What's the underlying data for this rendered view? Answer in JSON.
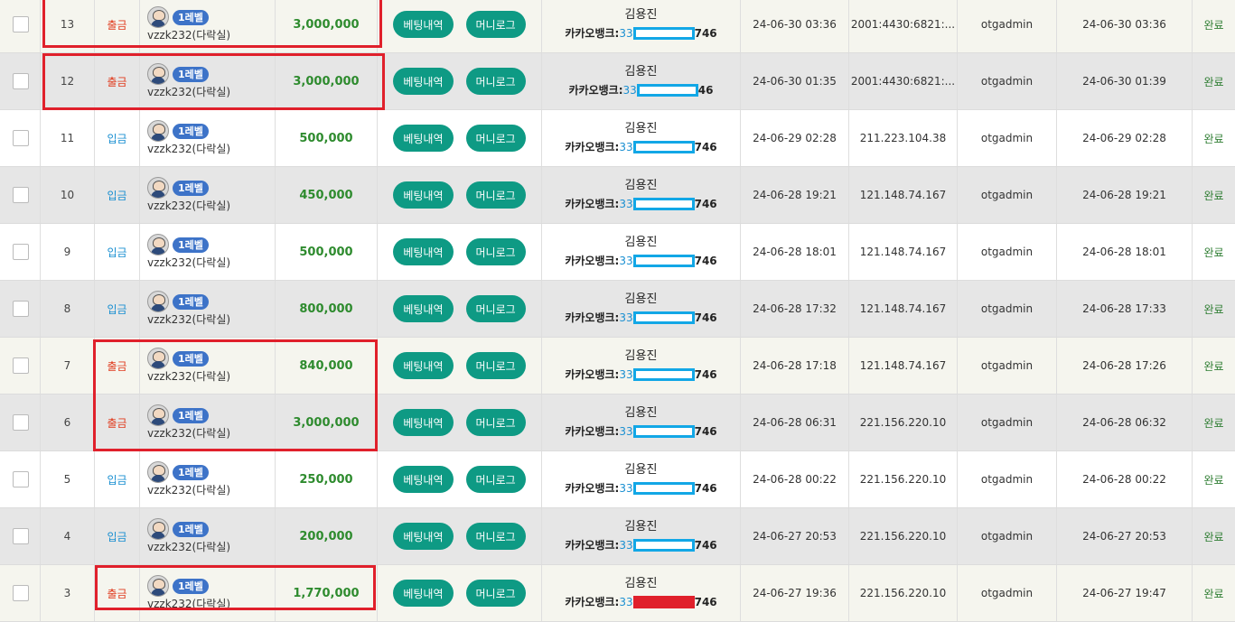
{
  "buttons": {
    "betting_label": "베팅내역",
    "money_label": "머니로그"
  },
  "rows": [
    {
      "no": "13",
      "type": "출금",
      "kind": "out",
      "level": "1레벨",
      "user": "vzzk232(다락실)",
      "amount": "3,000,000",
      "holder": "김용진",
      "bank_prefix": "카카오뱅크:",
      "acct_head": "33",
      "acct_tail": "746",
      "requested": "24-06-30 03:36",
      "ip": "2001:4430:6821:...",
      "admin": "otgadmin",
      "processed": "24-06-30 03:36",
      "status": "완료"
    },
    {
      "no": "12",
      "type": "출금",
      "kind": "out",
      "level": "1레벨",
      "user": "vzzk232(다락실)",
      "amount": "3,000,000",
      "holder": "김용진",
      "bank_prefix": "카카오뱅크:",
      "acct_head": "33",
      "acct_tail": "46",
      "requested": "24-06-30 01:35",
      "ip": "2001:4430:6821:...",
      "admin": "otgadmin",
      "processed": "24-06-30 01:39",
      "status": "완료"
    },
    {
      "no": "11",
      "type": "입금",
      "kind": "in",
      "level": "1레벨",
      "user": "vzzk232(다락실)",
      "amount": "500,000",
      "holder": "김용진",
      "bank_prefix": "카카오뱅크:",
      "acct_head": "33",
      "acct_tail": "746",
      "requested": "24-06-29 02:28",
      "ip": "211.223.104.38",
      "admin": "otgadmin",
      "processed": "24-06-29 02:28",
      "status": "완료"
    },
    {
      "no": "10",
      "type": "입금",
      "kind": "in",
      "level": "1레벨",
      "user": "vzzk232(다락실)",
      "amount": "450,000",
      "holder": "김용진",
      "bank_prefix": "카카오뱅크:",
      "acct_head": "33",
      "acct_tail": "746",
      "requested": "24-06-28 19:21",
      "ip": "121.148.74.167",
      "admin": "otgadmin",
      "processed": "24-06-28 19:21",
      "status": "완료"
    },
    {
      "no": "9",
      "type": "입금",
      "kind": "in",
      "level": "1레벨",
      "user": "vzzk232(다락실)",
      "amount": "500,000",
      "holder": "김용진",
      "bank_prefix": "카카오뱅크:",
      "acct_head": "33",
      "acct_tail": "746",
      "requested": "24-06-28 18:01",
      "ip": "121.148.74.167",
      "admin": "otgadmin",
      "processed": "24-06-28 18:01",
      "status": "완료"
    },
    {
      "no": "8",
      "type": "입금",
      "kind": "in",
      "level": "1레벨",
      "user": "vzzk232(다락실)",
      "amount": "800,000",
      "holder": "김용진",
      "bank_prefix": "카카오뱅크:",
      "acct_head": "33",
      "acct_tail": "746",
      "requested": "24-06-28 17:32",
      "ip": "121.148.74.167",
      "admin": "otgadmin",
      "processed": "24-06-28 17:33",
      "status": "완료"
    },
    {
      "no": "7",
      "type": "출금",
      "kind": "out",
      "level": "1레벨",
      "user": "vzzk232(다락실)",
      "amount": "840,000",
      "holder": "김용진",
      "bank_prefix": "카카오뱅크:",
      "acct_head": "33",
      "acct_tail": "746",
      "requested": "24-06-28 17:18",
      "ip": "121.148.74.167",
      "admin": "otgadmin",
      "processed": "24-06-28 17:26",
      "status": "완료"
    },
    {
      "no": "6",
      "type": "출금",
      "kind": "out",
      "level": "1레벨",
      "user": "vzzk232(다락실)",
      "amount": "3,000,000",
      "holder": "김용진",
      "bank_prefix": "카카오뱅크:",
      "acct_head": "33",
      "acct_tail": "746",
      "requested": "24-06-28 06:31",
      "ip": "221.156.220.10",
      "admin": "otgadmin",
      "processed": "24-06-28 06:32",
      "status": "완료"
    },
    {
      "no": "5",
      "type": "입금",
      "kind": "in",
      "level": "1레벨",
      "user": "vzzk232(다락실)",
      "amount": "250,000",
      "holder": "김용진",
      "bank_prefix": "카카오뱅크:",
      "acct_head": "33",
      "acct_tail": "746",
      "requested": "24-06-28 00:22",
      "ip": "221.156.220.10",
      "admin": "otgadmin",
      "processed": "24-06-28 00:22",
      "status": "완료"
    },
    {
      "no": "4",
      "type": "입금",
      "kind": "in",
      "level": "1레벨",
      "user": "vzzk232(다락실)",
      "amount": "200,000",
      "holder": "김용진",
      "bank_prefix": "카카오뱅크:",
      "acct_head": "33",
      "acct_tail": "746",
      "requested": "24-06-27 20:53",
      "ip": "221.156.220.10",
      "admin": "otgadmin",
      "processed": "24-06-27 20:53",
      "status": "완료"
    },
    {
      "no": "3",
      "type": "출금",
      "kind": "out",
      "level": "1레벨",
      "user": "vzzk232(다락실)",
      "amount": "1,770,000",
      "holder": "김용진",
      "bank_prefix": "카카오뱅크:",
      "acct_head": "33",
      "acct_tail": "746",
      "requested": "24-06-27 19:36",
      "ip": "221.156.220.10",
      "admin": "otgadmin",
      "processed": "24-06-27 19:47",
      "status": "완료"
    }
  ],
  "colors": {
    "deposit": "#1a8fd1",
    "withdraw": "#e03c1f",
    "amount": "#2e8b2e",
    "button": "#0e9a84",
    "level_badge": "#3d73c8",
    "mask_border": "#12a7e6",
    "highlight": "#e0202b"
  }
}
